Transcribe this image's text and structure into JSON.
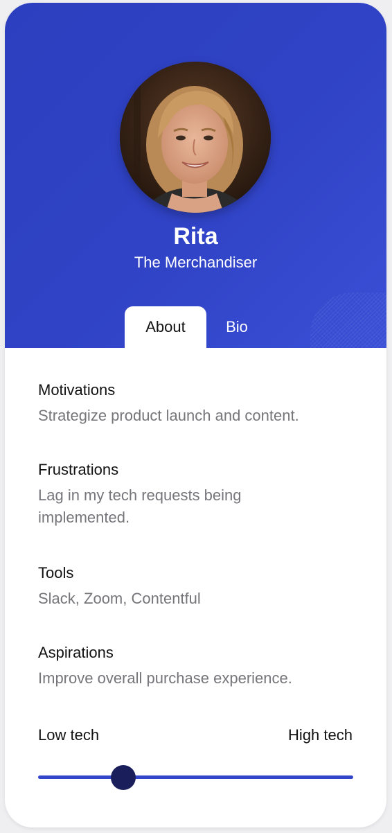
{
  "profile": {
    "name": "Rita",
    "role": "The Merchandiser",
    "avatar_icon": "woman-portrait-photo"
  },
  "tabs": [
    {
      "label": "About",
      "active": true
    },
    {
      "label": "Bio",
      "active": false
    }
  ],
  "sections": [
    {
      "title": "Motivations",
      "text": "Strategize product launch and content."
    },
    {
      "title": "Frustrations",
      "text": "Lag in my tech requests being implemented."
    },
    {
      "title": "Tools",
      "text": "Slack, Zoom, Contentful"
    },
    {
      "title": "Aspirations",
      "text": "Improve overall purchase experience."
    }
  ],
  "tech_scale": {
    "low_label": "Low tech",
    "high_label": "High tech",
    "value": 0.27
  },
  "colors": {
    "brand_blue": "#2f42c4",
    "thumb": "#1a1f5c",
    "muted_text": "#75757a"
  }
}
